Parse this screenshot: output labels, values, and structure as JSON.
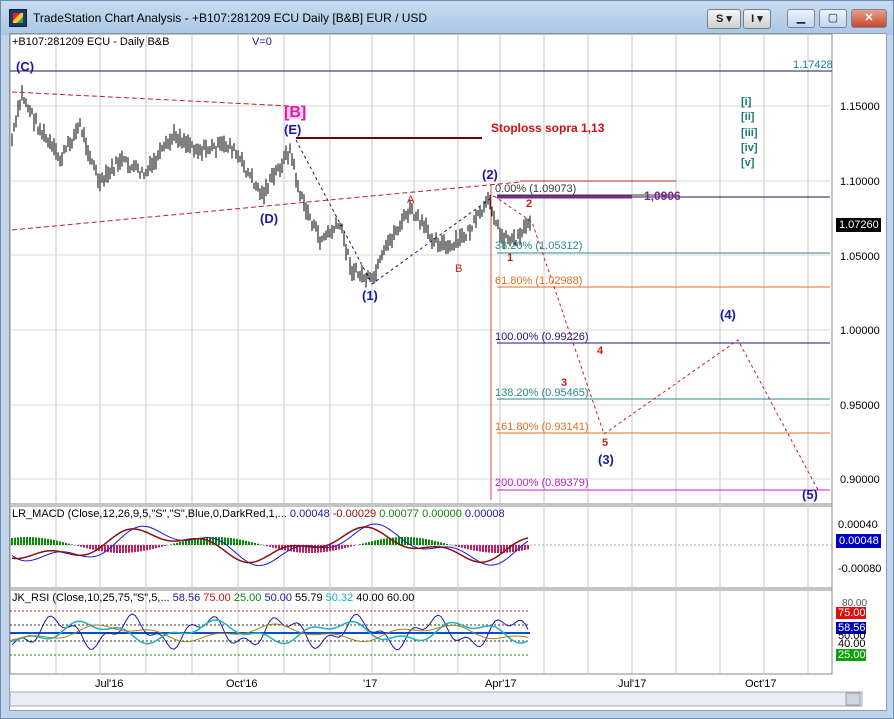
{
  "window": {
    "title": "TradeStation Chart Analysis - +B107:281209 ECU Daily [B&B] EUR / USD",
    "buttons": [
      "S",
      "I"
    ]
  },
  "header": {
    "symbol": "+B107:281209 ECU - Daily  B&B",
    "volume": "V=0"
  },
  "price_axis": [
    "1.15000",
    "1.10000",
    "1.05000",
    "1.00000",
    "0.95000",
    "0.90000"
  ],
  "price_top": "1.17428",
  "last_price": "1.07260",
  "annotations": {
    "stoploss": "Stoploss sopra 1,13",
    "level_1090": "1,0906",
    "wave_C": "(C)",
    "wave_B": "[B]",
    "wave_E": "(E)",
    "wave_D": "(D)",
    "wave_1p": "(1)",
    "wave_2p": "(2)",
    "wave_3p": "(3)",
    "wave_4p": "(4)",
    "wave_5p": "(5)",
    "A": "A",
    "B": "B",
    "n1": "1",
    "n2": "2",
    "n3": "3",
    "n4": "4",
    "n5": "5"
  },
  "fib_levels": [
    {
      "label": "0.00% (1.09073)",
      "color": "#3a3a3a"
    },
    {
      "label": "38.20% (1.05312)",
      "color": "#2a8a8a"
    },
    {
      "label": "61.80% (1.02988)",
      "color": "#e07020"
    },
    {
      "label": "100.00% (0.99226)",
      "color": "#1a1a7a"
    },
    {
      "label": "138.20% (0.95465)",
      "color": "#2a8a8a"
    },
    {
      "label": "161.80% (0.93141)",
      "color": "#e07020"
    },
    {
      "label": "200.00% (0.89379)",
      "color": "#c020c0"
    }
  ],
  "wave_legend": [
    "[i]",
    "[ii]",
    "[iii]",
    "[iv]",
    "[v]"
  ],
  "macd": {
    "header": "LR_MACD (Close,12,26,9,5,\"S\",\"S\",Blue,0,DarkRed,1,...",
    "values": [
      "0.00048",
      "-0.00029",
      "0.00077",
      "0.00000",
      "0.00008"
    ],
    "axis": [
      "0.00040",
      "-0.00080"
    ],
    "last": "0.00048"
  },
  "rsi": {
    "header": "JK_RSI (Close,10,25,75,\"S\",5,...",
    "values": [
      "58.56",
      "75.00",
      "25.00",
      "50.00",
      "55.79",
      "50.32",
      "40.00",
      "60.00"
    ],
    "axis_top": "80.00",
    "tags": [
      "75.00",
      "58.56",
      "50.00",
      "40.00",
      "25.00"
    ]
  },
  "time_axis": [
    "Jul'16",
    "Oct'16",
    "'17",
    "Apr'17",
    "Jul'17",
    "Oct'17"
  ],
  "colors": {
    "accent": "#1a1aa0",
    "resistance": "#c02020",
    "bars": "#000000"
  }
}
